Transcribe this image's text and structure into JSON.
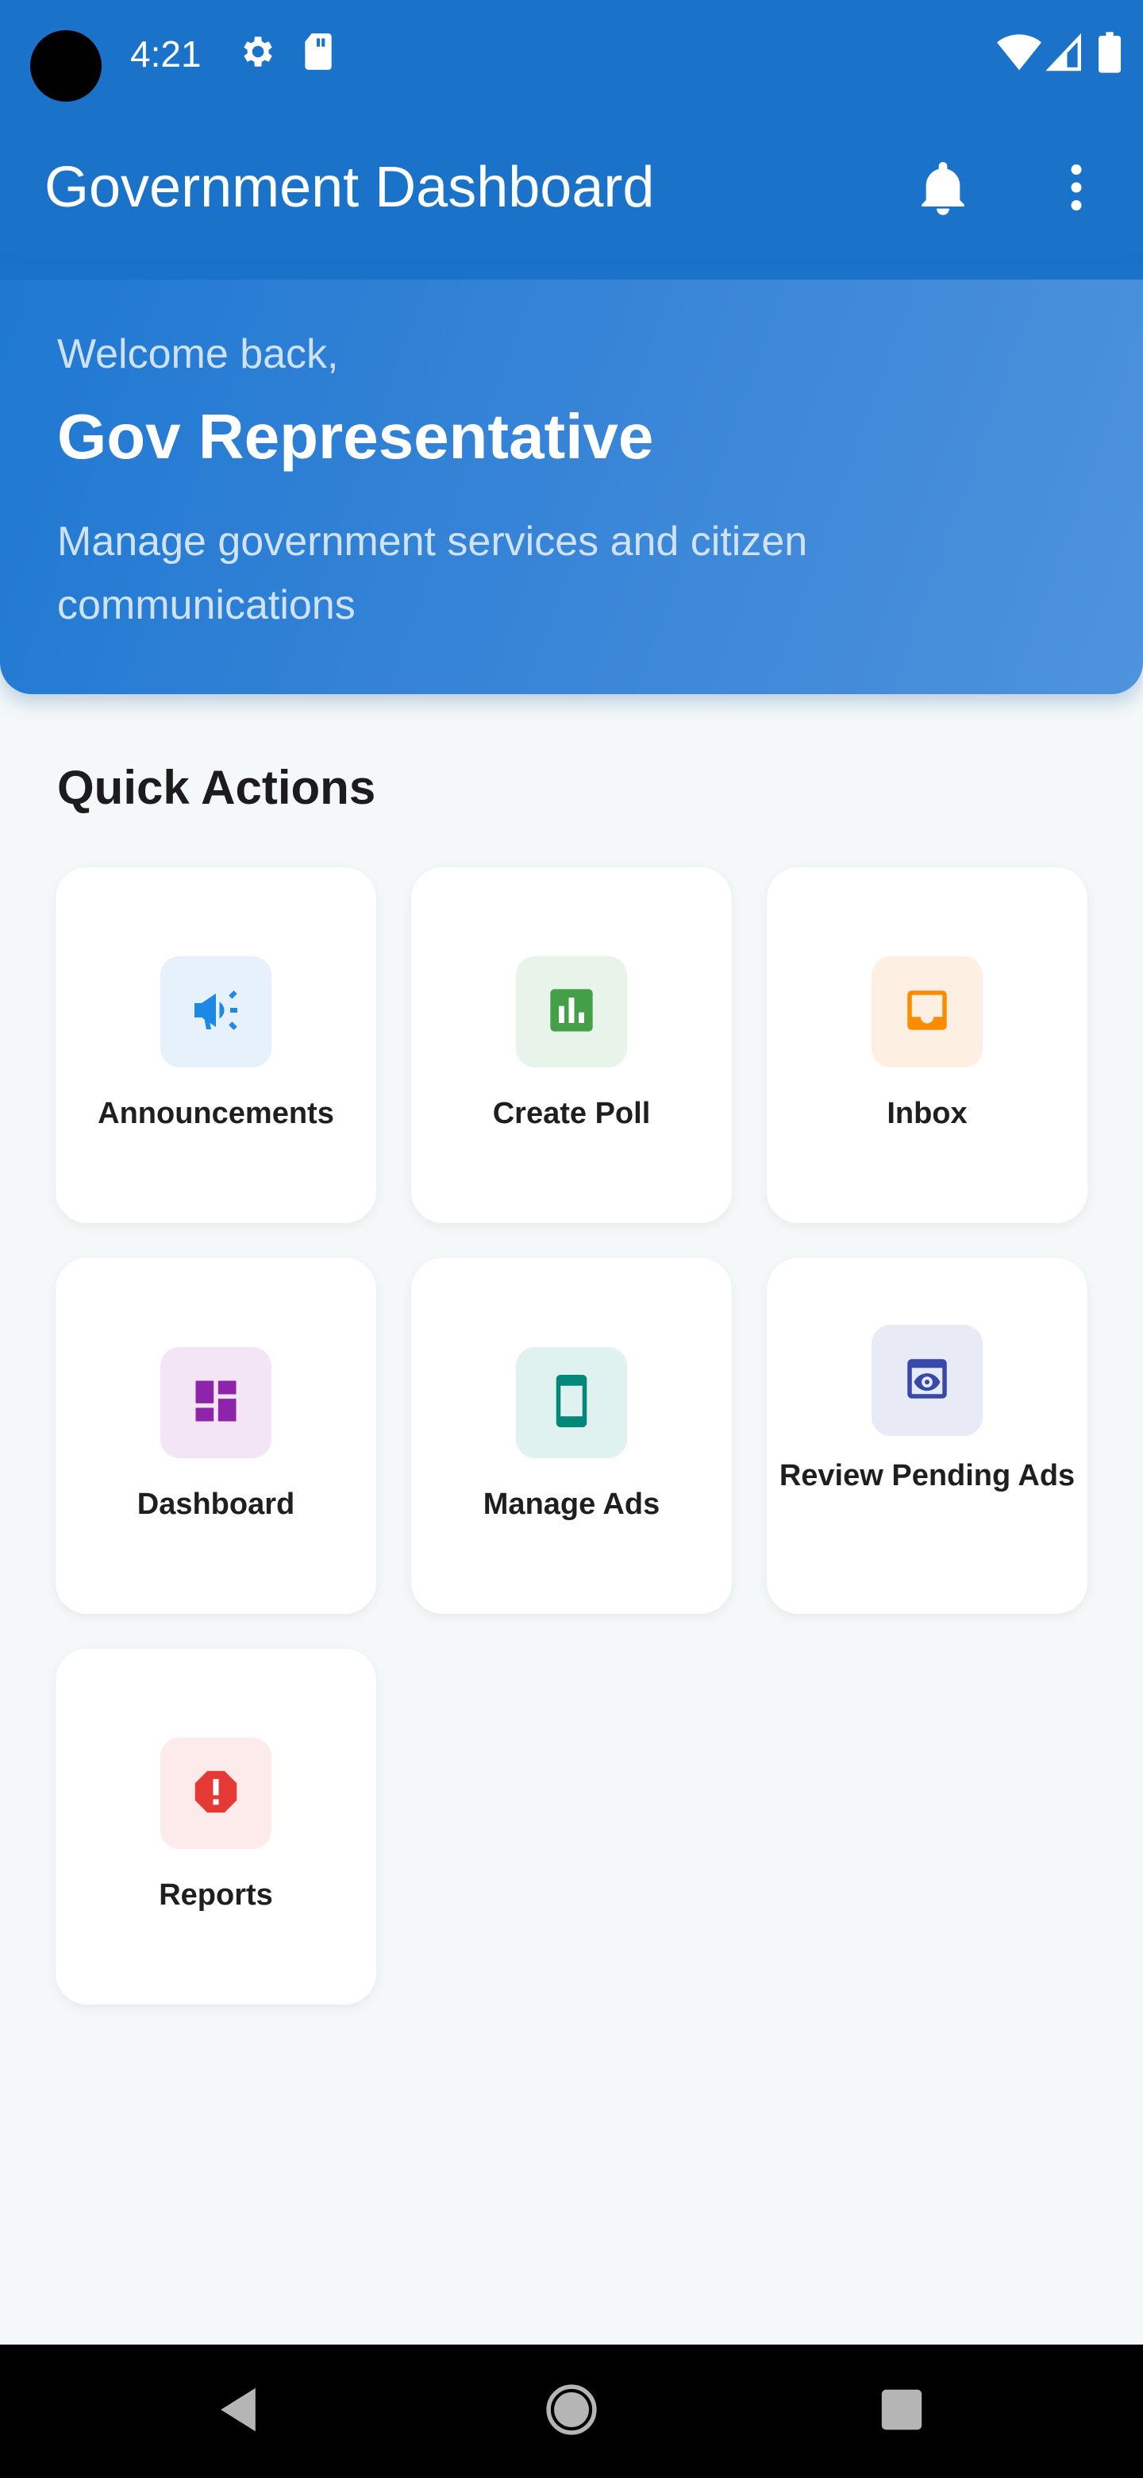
{
  "status_bar": {
    "time": "4:21",
    "icons": [
      "settings-icon",
      "sd-card-icon",
      "wifi-icon",
      "signal-icon",
      "battery-icon"
    ]
  },
  "app_bar": {
    "title": "Government Dashboard",
    "actions": [
      "notifications-bell-icon",
      "more-vert-icon"
    ]
  },
  "hero": {
    "welcome": "Welcome back,",
    "name": "Gov Representative",
    "subtitle": "Manage government services and citizen communications"
  },
  "quick_actions": {
    "title": "Quick Actions",
    "items": [
      {
        "label": "Announcements",
        "icon": "campaign-megaphone-icon",
        "icon_color": "#1e88e5",
        "bg_color": "#e6f1fc"
      },
      {
        "label": "Create Poll",
        "icon": "poll-chart-icon",
        "icon_color": "#43a047",
        "bg_color": "#e8f4ea"
      },
      {
        "label": "Inbox",
        "icon": "inbox-tray-icon",
        "icon_color": "#fb8c00",
        "bg_color": "#fdf0e3"
      },
      {
        "label": "Dashboard",
        "icon": "dashboard-grid-icon",
        "icon_color": "#8e24aa",
        "bg_color": "#f3e4f6"
      },
      {
        "label": "Manage Ads",
        "icon": "phone-ads-icon",
        "icon_color": "#00897b",
        "bg_color": "#e0f2f0"
      },
      {
        "label": "Review Pending Ads",
        "icon": "preview-eye-icon",
        "icon_color": "#3949ab",
        "bg_color": "#e8eaf6"
      },
      {
        "label": "Reports",
        "icon": "report-alert-icon",
        "icon_color": "#e53935",
        "bg_color": "#fdeaea"
      }
    ]
  },
  "nav_bar": {
    "buttons": [
      "back-icon",
      "home-icon",
      "recents-icon"
    ]
  },
  "colors": {
    "primary": "#1a73c9",
    "background": "#f4f8f9"
  }
}
